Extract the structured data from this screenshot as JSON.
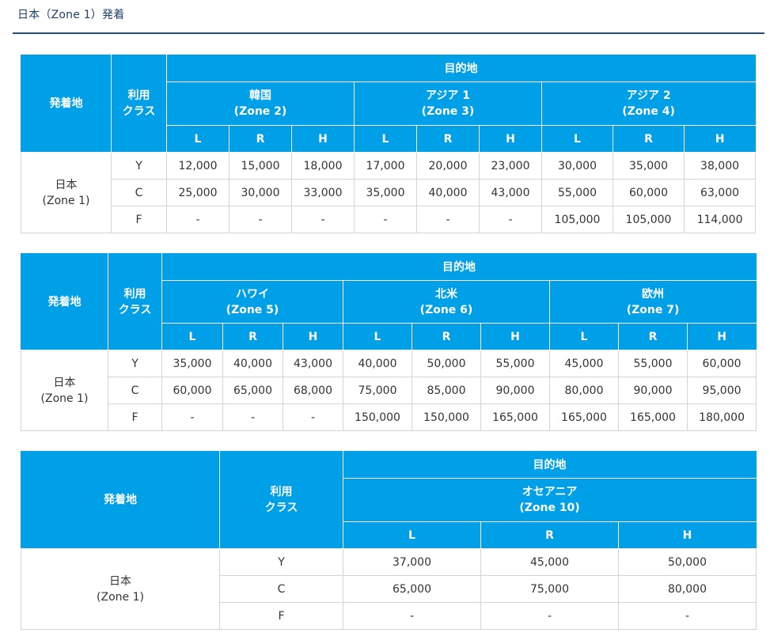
{
  "page_title": "日本（Zone 1）発着",
  "headers": {
    "origin": "発着地",
    "class_line1": "利用",
    "class_line2": "クラス",
    "destination": "目的地"
  },
  "seasons": [
    "L",
    "R",
    "H"
  ],
  "origin_label": {
    "line1": "日本",
    "line2": "(Zone 1)"
  },
  "classes": [
    "Y",
    "C",
    "F"
  ],
  "tables": [
    {
      "zones": [
        {
          "name": "韓国",
          "zone": "(Zone 2)"
        },
        {
          "name": "アジア 1",
          "zone": "(Zone 3)"
        },
        {
          "name": "アジア 2",
          "zone": "(Zone 4)"
        }
      ],
      "rows": [
        [
          "12,000",
          "15,000",
          "18,000",
          "17,000",
          "20,000",
          "23,000",
          "30,000",
          "35,000",
          "38,000"
        ],
        [
          "25,000",
          "30,000",
          "33,000",
          "35,000",
          "40,000",
          "43,000",
          "55,000",
          "60,000",
          "63,000"
        ],
        [
          "-",
          "-",
          "-",
          "-",
          "-",
          "-",
          "105,000",
          "105,000",
          "114,000"
        ]
      ]
    },
    {
      "zones": [
        {
          "name": "ハワイ",
          "zone": "(Zone 5)"
        },
        {
          "name": "北米",
          "zone": "(Zone 6)"
        },
        {
          "name": "欧州",
          "zone": "(Zone 7)"
        }
      ],
      "rows": [
        [
          "35,000",
          "40,000",
          "43,000",
          "40,000",
          "50,000",
          "55,000",
          "45,000",
          "55,000",
          "60,000"
        ],
        [
          "60,000",
          "65,000",
          "68,000",
          "75,000",
          "85,000",
          "90,000",
          "80,000",
          "90,000",
          "95,000"
        ],
        [
          "-",
          "-",
          "-",
          "150,000",
          "150,000",
          "165,000",
          "165,000",
          "165,000",
          "180,000"
        ]
      ]
    },
    {
      "zones": [
        {
          "name": "オセアニア",
          "zone": "(Zone 10)"
        }
      ],
      "rows": [
        [
          "37,000",
          "45,000",
          "50,000"
        ],
        [
          "65,000",
          "75,000",
          "80,000"
        ],
        [
          "-",
          "-",
          "-"
        ]
      ]
    }
  ]
}
